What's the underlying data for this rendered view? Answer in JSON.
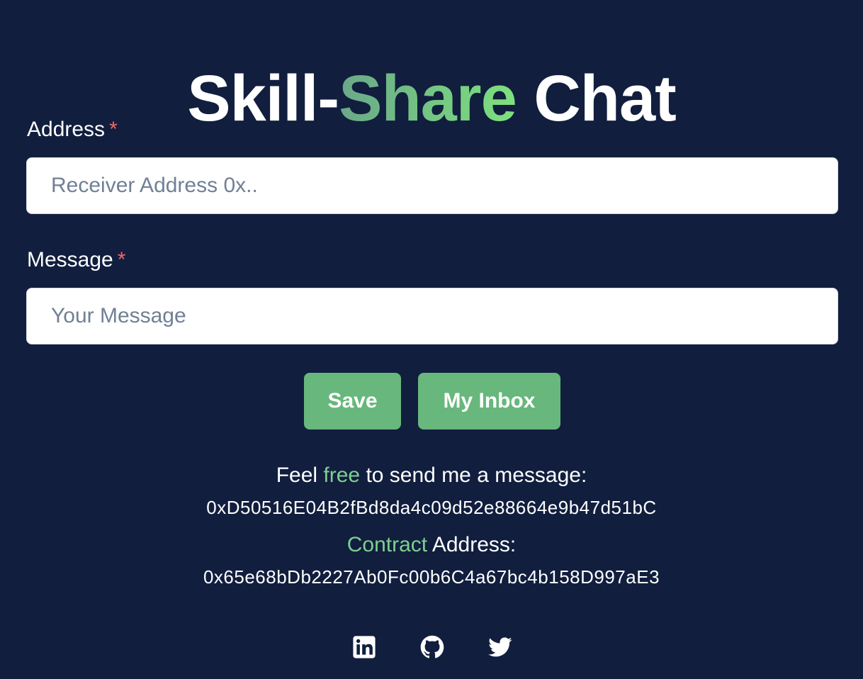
{
  "header": {
    "title_part1": "Skill-",
    "title_part2": "Share",
    "title_part3": " Chat"
  },
  "form": {
    "address": {
      "label": "Address",
      "required_mark": "*",
      "placeholder": "Receiver Address 0x..",
      "value": ""
    },
    "message": {
      "label": "Message",
      "required_mark": "*",
      "placeholder": "Your Message",
      "value": ""
    },
    "save_label": "Save",
    "inbox_label": "My Inbox"
  },
  "info": {
    "feel_prefix": "Feel ",
    "feel_accent": "free",
    "feel_suffix": " to send me a message:",
    "owner_address": "0xD50516E04B2fBd8da4c09d52e88664e9b47d51bC",
    "contract_accent": "Contract",
    "contract_suffix": " Address:",
    "contract_address": "0x65e68bDb2227Ab0Fc00b6C4a67bc4b158D997aE3"
  },
  "socials": [
    {
      "icon": "linkedin-icon"
    },
    {
      "icon": "github-icon"
    },
    {
      "icon": "twitter-icon"
    }
  ],
  "colors": {
    "background": "#111e3e",
    "accent_green": "#7dd08f",
    "button_green": "#68b77c",
    "required_red": "#f56565"
  }
}
